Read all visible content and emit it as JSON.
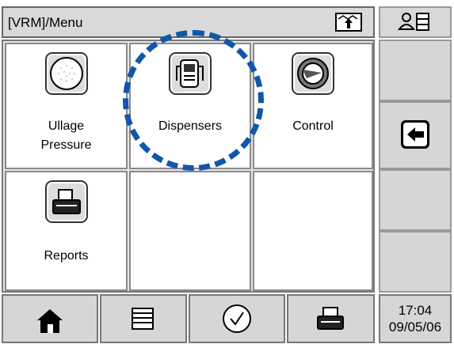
{
  "header": {
    "title": "[VRM]/Menu"
  },
  "menu": {
    "items": [
      {
        "label": "Ullage\nPressure"
      },
      {
        "label": "Dispensers"
      },
      {
        "label": "Control"
      },
      {
        "label": "Reports"
      }
    ]
  },
  "status": {
    "time": "17:04",
    "date": "09/05/06"
  },
  "icons": {
    "sync": "arrow-up-icon",
    "user_list": "user-list-icon",
    "back": "left-arrow-icon",
    "home": "home-icon",
    "list": "list-icon",
    "check": "check-icon",
    "printer": "printer-icon"
  },
  "colors": {
    "highlight": "#1057a8"
  }
}
